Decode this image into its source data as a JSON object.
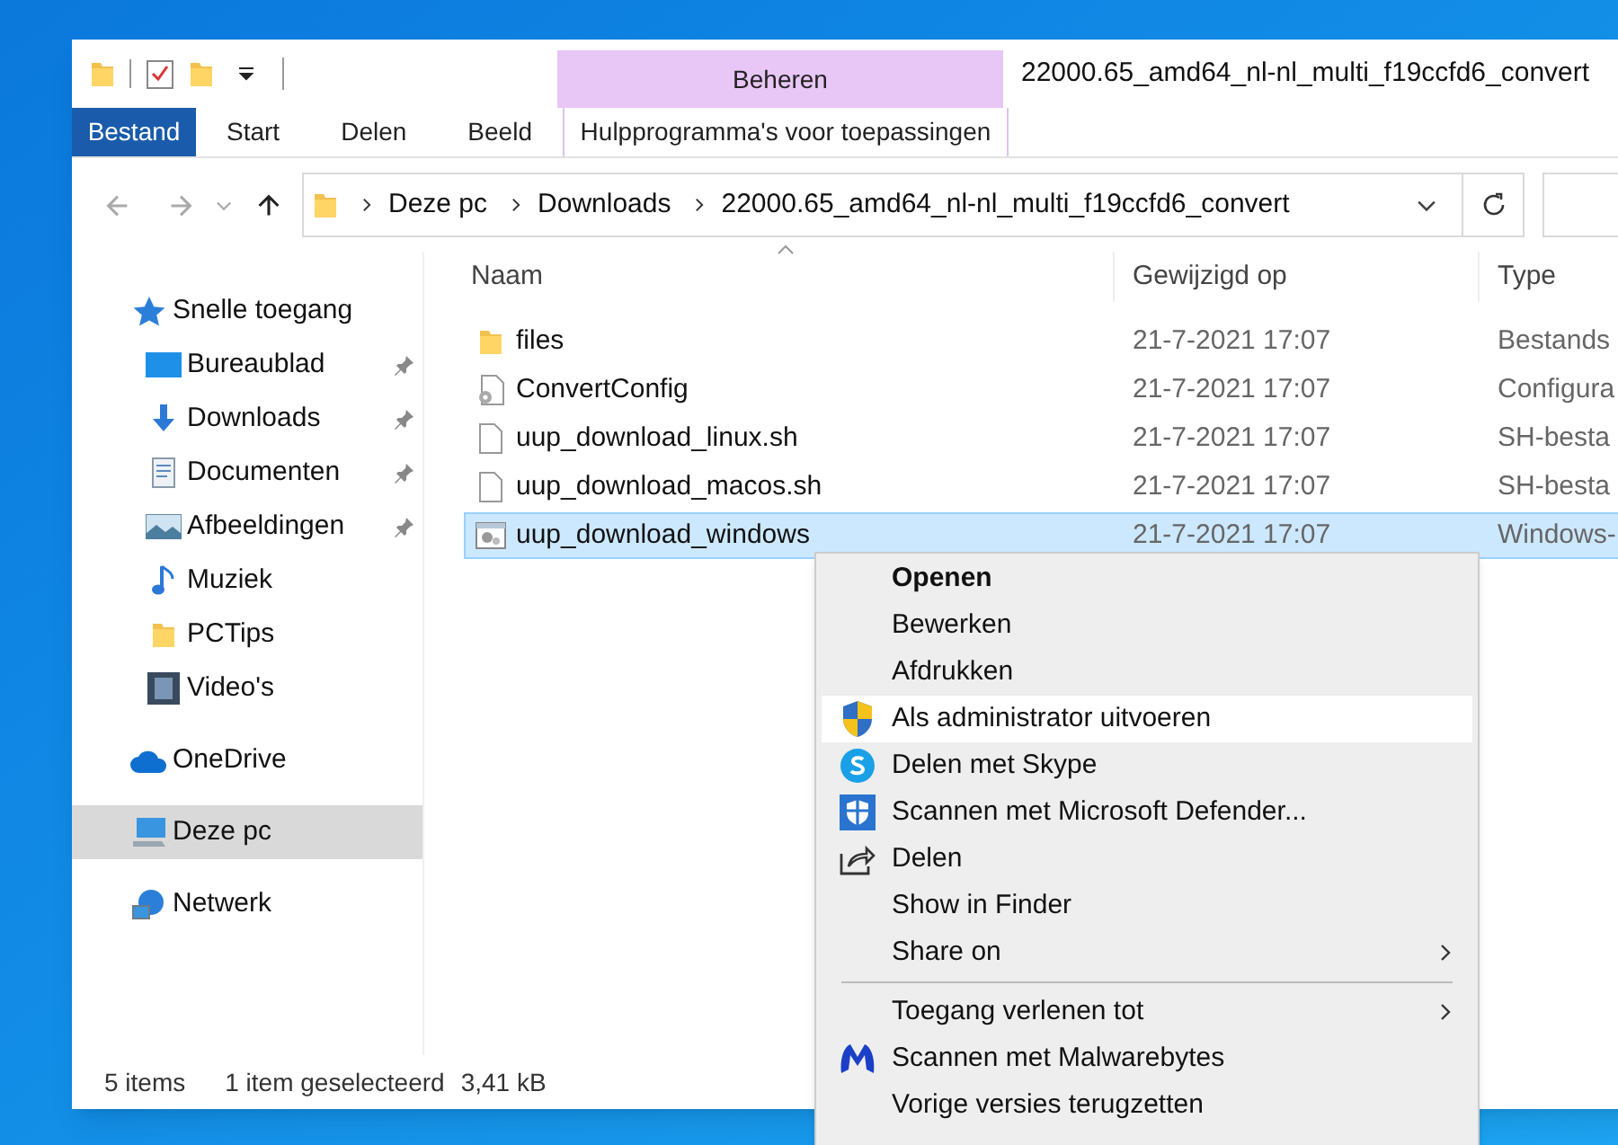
{
  "window": {
    "title": "22000.65_amd64_nl-nl_multi_f19ccfd6_convert"
  },
  "ribbon": {
    "contextual_group": "Beheren",
    "tabs": [
      {
        "label": "Bestand",
        "kind": "file"
      },
      {
        "label": "Start",
        "kind": "tab"
      },
      {
        "label": "Delen",
        "kind": "tab"
      },
      {
        "label": "Beeld",
        "kind": "tab"
      },
      {
        "label": "Hulpprogramma's voor toepassingen",
        "kind": "contextual"
      }
    ]
  },
  "address_bar": {
    "breadcrumbs": [
      "Deze pc",
      "Downloads",
      "22000.65_amd64_nl-nl_multi_f19ccfd6_convert"
    ]
  },
  "sidebar": {
    "items": [
      {
        "label": "Snelle toegang",
        "selected": false,
        "children": [
          {
            "label": "Bureaublad",
            "pinned": true,
            "selected": false
          },
          {
            "label": "Downloads",
            "pinned": true,
            "selected": false
          },
          {
            "label": "Documenten",
            "pinned": true,
            "selected": false
          },
          {
            "label": "Afbeeldingen",
            "pinned": true,
            "selected": false
          },
          {
            "label": "Muziek",
            "pinned": false,
            "selected": false
          },
          {
            "label": "PCTips",
            "pinned": false,
            "selected": false
          },
          {
            "label": "Video's",
            "pinned": false,
            "selected": false
          }
        ]
      },
      {
        "label": "OneDrive",
        "selected": false
      },
      {
        "label": "Deze pc",
        "selected": true
      },
      {
        "label": "Netwerk",
        "selected": false
      }
    ]
  },
  "table": {
    "columns": [
      "Naam",
      "Gewijzigd op",
      "Type"
    ],
    "rows": [
      {
        "kind": "folder",
        "name": "files",
        "modified": "21-7-2021 17:07",
        "type": "Bestands",
        "selected": false
      },
      {
        "kind": "config",
        "name": "ConvertConfig",
        "modified": "21-7-2021 17:07",
        "type": "Configura",
        "selected": false
      },
      {
        "kind": "file",
        "name": "uup_download_linux.sh",
        "modified": "21-7-2021 17:07",
        "type": "SH-besta",
        "selected": false
      },
      {
        "kind": "file",
        "name": "uup_download_macos.sh",
        "modified": "21-7-2021 17:07",
        "type": "SH-besta",
        "selected": false
      },
      {
        "kind": "batch",
        "name": "uup_download_windows",
        "modified": "21-7-2021 17:07",
        "type": "Windows-",
        "selected": true
      }
    ]
  },
  "context_menu": {
    "groups": [
      [
        {
          "label": "Openen",
          "bold": true,
          "selected": false,
          "submenu": false
        },
        {
          "label": "Bewerken",
          "bold": false,
          "selected": false,
          "submenu": false
        },
        {
          "label": "Afdrukken",
          "bold": false,
          "selected": false,
          "submenu": false
        },
        {
          "label": "Als administrator uitvoeren",
          "bold": false,
          "selected": true,
          "submenu": false
        },
        {
          "label": "Delen met Skype",
          "bold": false,
          "selected": false,
          "submenu": false
        },
        {
          "label": "Scannen met Microsoft Defender...",
          "bold": false,
          "selected": false,
          "submenu": false
        },
        {
          "label": "Delen",
          "bold": false,
          "selected": false,
          "submenu": false
        },
        {
          "label": "Show in Finder",
          "bold": false,
          "selected": false,
          "submenu": false
        },
        {
          "label": "Share on",
          "bold": false,
          "selected": false,
          "submenu": true
        }
      ],
      [
        {
          "label": "Toegang verlenen tot",
          "bold": false,
          "selected": false,
          "submenu": true
        },
        {
          "label": "Scannen met Malwarebytes",
          "bold": false,
          "selected": false,
          "submenu": false
        },
        {
          "label": "Vorige versies terugzetten",
          "bold": false,
          "selected": false,
          "submenu": false
        }
      ]
    ]
  },
  "status_bar": {
    "item_count": "5 items",
    "selection": "1 item geselecteerd",
    "size": "3,41 kB"
  }
}
